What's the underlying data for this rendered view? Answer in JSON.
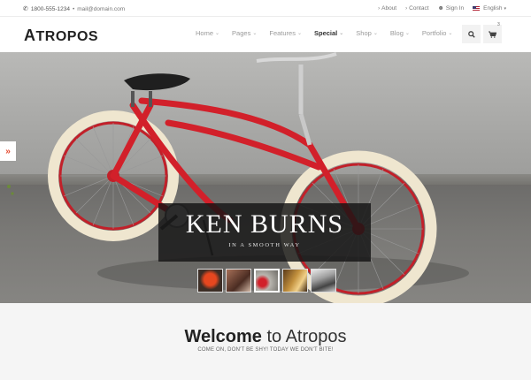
{
  "topbar": {
    "phone": "1800-555-1234",
    "separator": "•",
    "email": "mail@domain.com",
    "about": "About",
    "contact": "Contact",
    "signin": "Sign In",
    "language": "English"
  },
  "header": {
    "logo_first": "A",
    "logo_rest": "TROPOS",
    "nav": [
      "Home",
      "Pages",
      "Features",
      "Special",
      "Shop",
      "Blog",
      "Portfolio"
    ],
    "active_nav": "Special",
    "cart_count": "3"
  },
  "hero": {
    "title": "KEN BURNS",
    "subtitle": "IN A SMOOTH WAY",
    "thumbnail_count": "5",
    "active_thumbnail": "3"
  },
  "welcome": {
    "title_bold": "Welcome",
    "title_rest": " to Atropos",
    "subtitle": "COME ON, DON'T BE SHY! TODAY WE DON'T BITE!"
  },
  "colors": {
    "accent": "#e5482d",
    "bike_red": "#d2202a"
  }
}
